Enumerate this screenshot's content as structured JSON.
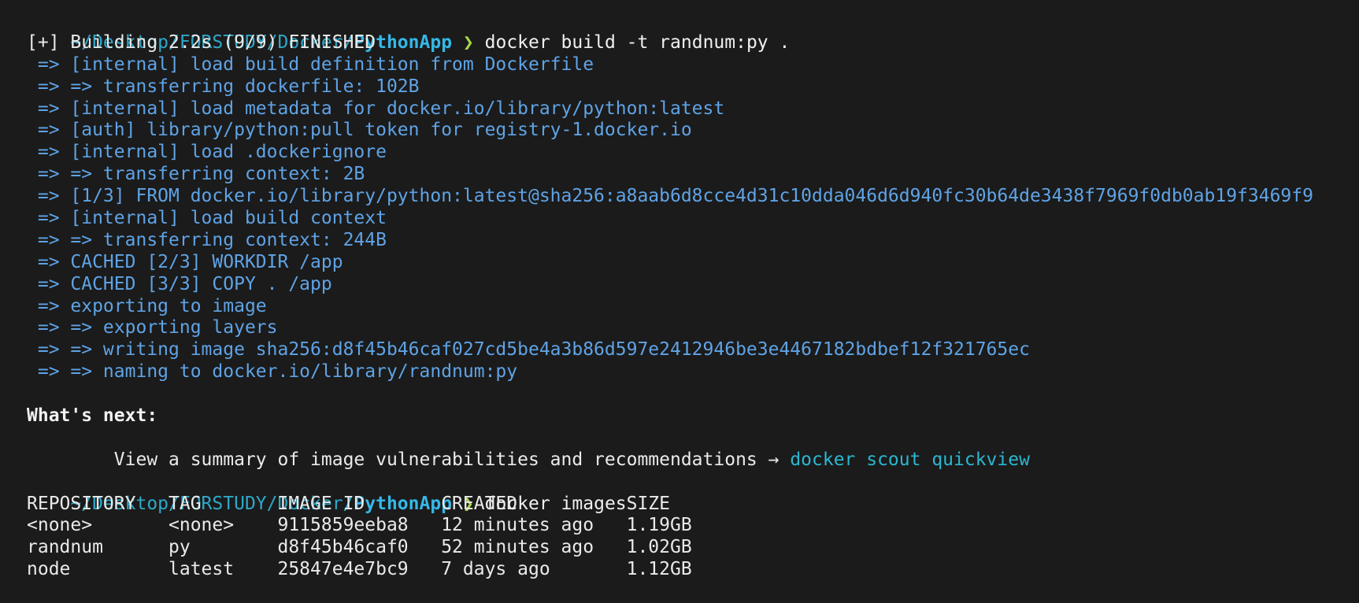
{
  "prompt1": {
    "path": "~/Desktop/FORSTUDY/Docker/",
    "dir": "PythonApp",
    "arrow": "❯",
    "command": "docker build -t randnum:py ."
  },
  "build": {
    "header": "[+] Building 2.2s (9/9) FINISHED",
    "steps": [
      " => [internal] load build definition from Dockerfile",
      " => => transferring dockerfile: 102B",
      " => [internal] load metadata for docker.io/library/python:latest",
      " => [auth] library/python:pull token for registry-1.docker.io",
      " => [internal] load .dockerignore",
      " => => transferring context: 2B",
      " => [1/3] FROM docker.io/library/python:latest@sha256:a8aab6d8cce4d31c10dda046d6d940fc30b64de3438f7969f0db0ab19f3469f9",
      " => [internal] load build context",
      " => => transferring context: 244B",
      " => CACHED [2/3] WORKDIR /app",
      " => CACHED [3/3] COPY . /app",
      " => exporting to image",
      " => => exporting layers",
      " => => writing image sha256:d8f45b46caf027cd5be4a3b86d597e2412946be3e4467182bdbef12f321765ec",
      " => => naming to docker.io/library/randnum:py"
    ]
  },
  "whats_next": {
    "title": "What's next:",
    "text": "    View a summary of image vulnerabilities and recommendations → ",
    "command": "docker scout quickview"
  },
  "prompt2": {
    "path": "~/Desktop/FORSTUDY/Docker/",
    "dir": "PythonApp",
    "arrow": "❯",
    "command": "docker images"
  },
  "images_table": {
    "header": "REPOSITORY   TAG       IMAGE ID       CREATED          SIZE",
    "rows": [
      "<none>       <none>    9115859eeba8   12 minutes ago   1.19GB",
      "randnum      py        d8f45b46caf0   52 minutes ago   1.02GB",
      "node         latest    25847e4e7bc9   7 days ago       1.12GB"
    ]
  }
}
